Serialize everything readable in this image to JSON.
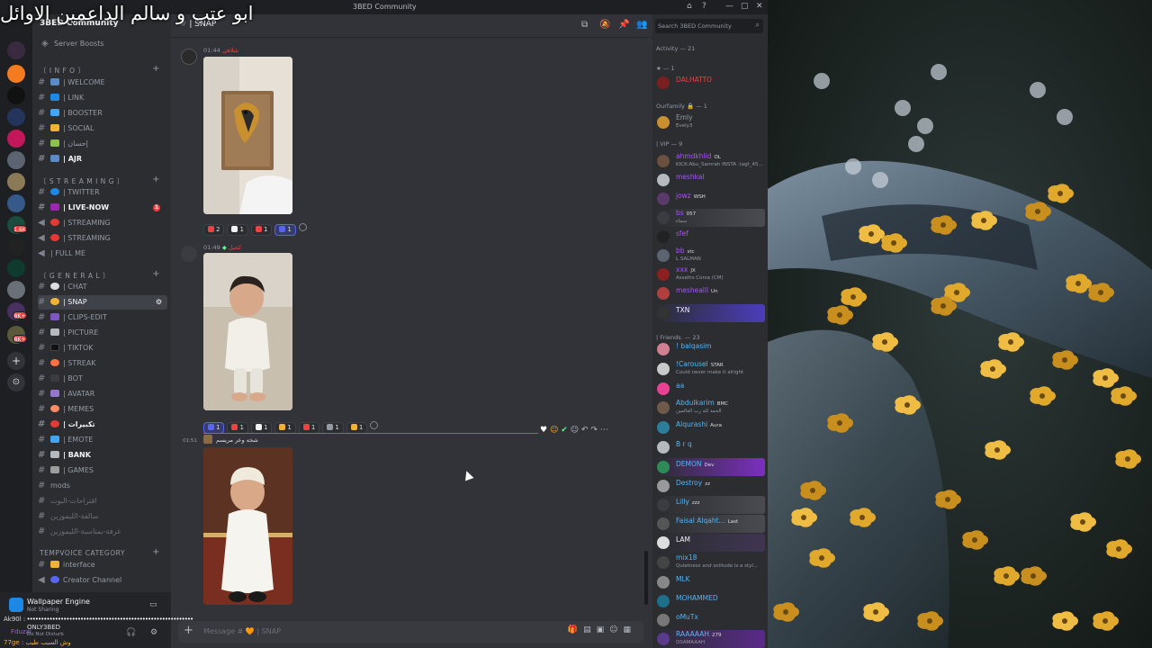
{
  "overlay_title": "ابو عتب و سالم الداعمين الاوائل",
  "window": {
    "title": "3BED Community",
    "controls": [
      "—",
      "▢",
      "✕"
    ]
  },
  "server": {
    "name": "3BED Community",
    "boosts_label": "Server Boosts"
  },
  "server_rail": {
    "badges": [
      "1.6K",
      "8K+",
      "8K+"
    ]
  },
  "categories": {
    "info": "〔 I N F O 〕",
    "streaming": "〔 S T R E A M I N G 〕",
    "general": "〔 G E N E R A L 〕",
    "tempvoice": "TEMPVOICE CATEGORY"
  },
  "channels": {
    "welcome": "| WELCOME",
    "link": "| LINK",
    "booster": "| BOOSTER",
    "social": "| SOCIAL",
    "ihsan": "| إحسان",
    "ajr": "| AJR",
    "twitter": "| TWITTER",
    "live_now": "| LIVE-NOW",
    "live_now_badge": "1",
    "streaming1": "| STREAMING",
    "streaming2": "| STREAMING",
    "full_me": "| FULL ME",
    "chat": "| CHAT",
    "snap": "| SNAP",
    "clips_edit": "| CLIPS-EDIT",
    "picture": "| PICTURE",
    "tiktok": "| TIKTOK",
    "streak": "| STREAK",
    "bot": "| BOT",
    "avatar": "| AVATAR",
    "memes": "| MEMES",
    "takbirat": "| تكبيرات",
    "emote": "| EMOTE",
    "bank": "| BANK",
    "games": "| GAMES",
    "mods": "mods",
    "iqtirahat": "اقتراحات-البوت",
    "salfa": "سالفة-الليموزين",
    "ghurfa": "غرفة-بمناسبة-الليموزين",
    "interface": "interface",
    "creator": "Creator Channel"
  },
  "user_panel": {
    "activity_name": "Wallpaper Engine",
    "activity_status": "Not Sharing",
    "line1": "Ak90l :",
    "line2": "ONLY3BED",
    "line3": "Fduzal",
    "line3_status": "Do Not Disturb",
    "line4": "77ge : وش السبب طيب"
  },
  "chat": {
    "channel_label": "| SNAP",
    "composer_placeholder": "Message # 🧡 | SNAP",
    "messages": [
      {
        "author": "ﺷﻠﺎﻫﻲ",
        "time": "01:44",
        "reactions": [
          {
            "count": "2",
            "color": "#f23f43"
          },
          {
            "count": "1",
            "color": "#f2f3f5"
          },
          {
            "count": "1",
            "color": "#ed4245"
          },
          {
            "count": "1",
            "color": "#5865f2",
            "label": "10"
          }
        ]
      },
      {
        "author": "ﻛﺤﻴﻞ",
        "time": "01:49",
        "reactions": [
          {
            "count": "1",
            "color": "#5865f2",
            "label": "10"
          },
          {
            "count": "1",
            "color": "#ed4245"
          },
          {
            "count": "1",
            "color": "#f2f3f5"
          },
          {
            "count": "1",
            "color": "#f0b232"
          },
          {
            "count": "1",
            "color": "#ed4245"
          },
          {
            "count": "1",
            "color": "#949ba4"
          },
          {
            "count": "1",
            "color": "#f0b232"
          }
        ]
      },
      {
        "author": "ﺷﺨﻪ ﻭﻋﺮ ﻣﺮﻳﺴﻢ",
        "time": "01:51"
      }
    ]
  },
  "members": {
    "search_placeholder": "Search 3BED Community",
    "groups": {
      "activity": "Activity — 21",
      "star": "★ — 1",
      "ourfamily": "Ourfamily 🔒 — 1",
      "vip": "| VIP — 9",
      "friends": "| Friends. — 23"
    },
    "list": [
      {
        "name": "DALHATTO",
        "color": "#f23f43"
      },
      {
        "name": "Emly",
        "color": "#949ba4",
        "status": "Evely3"
      },
      {
        "name": "ahmdkhlid",
        "color": "#a855f7",
        "tag": "OL",
        "status": "KICK:Abu_Samrah INSTA :(agt_45..."
      },
      {
        "name": "meshkal",
        "color": "#a855f7"
      },
      {
        "name": "jowz",
        "color": "#a855f7",
        "tag": "WSH"
      },
      {
        "name": "bs",
        "color": "#a855f7",
        "tag": "057",
        "status": "سماء"
      },
      {
        "name": "sfef",
        "color": "#a855f7"
      },
      {
        "name": "bb",
        "color": "#a855f7",
        "tag": "stc",
        "status": "L SALMAN"
      },
      {
        "name": "xxx",
        "color": "#a855f7",
        "tag": "JX",
        "status": "Assetto Corsa (CM)"
      },
      {
        "name": "meshealll",
        "color": "#a855f7",
        "tag": "Un"
      },
      {
        "name": "TXN",
        "color": "#f2f3f5"
      },
      {
        "name": "! balqasim",
        "color": "#5ab4f0"
      },
      {
        "name": "!Carousel",
        "color": "#5ab4f0",
        "tag": "STAR",
        "status": "Could never make it alright"
      },
      {
        "name": "aa",
        "color": "#5ab4f0"
      },
      {
        "name": "Abdulkarim",
        "color": "#5ab4f0",
        "tag": "BMC",
        "status": "الحمد لله رب العالمين"
      },
      {
        "name": "Alqurashi",
        "color": "#5ab4f0",
        "tag": "Aura"
      },
      {
        "name": "B r q",
        "color": "#5ab4f0"
      },
      {
        "name": "DEMON",
        "color": "#5ab4f0",
        "tag": "Dev"
      },
      {
        "name": "Destroy",
        "color": "#5ab4f0",
        "tag": "zz"
      },
      {
        "name": "Lilly",
        "color": "#5ab4f0",
        "tag": "zzz"
      },
      {
        "name": "Faisal Alqaht...",
        "color": "#5ab4f0",
        "tag": "Last"
      },
      {
        "name": "LAM",
        "color": "#f2f3f5"
      },
      {
        "name": "mix18",
        "color": "#5ab4f0",
        "status": "Quietness and solitude is a styl..."
      },
      {
        "name": "MLK",
        "color": "#5ab4f0"
      },
      {
        "name": "MOHAMMED",
        "color": "#5ab4f0"
      },
      {
        "name": "oMuTx",
        "color": "#5ab4f0"
      },
      {
        "name": "RAAAAAH",
        "color": "#5ab4f0",
        "tag": "279",
        "status": "OSAMAAAH"
      }
    ]
  }
}
